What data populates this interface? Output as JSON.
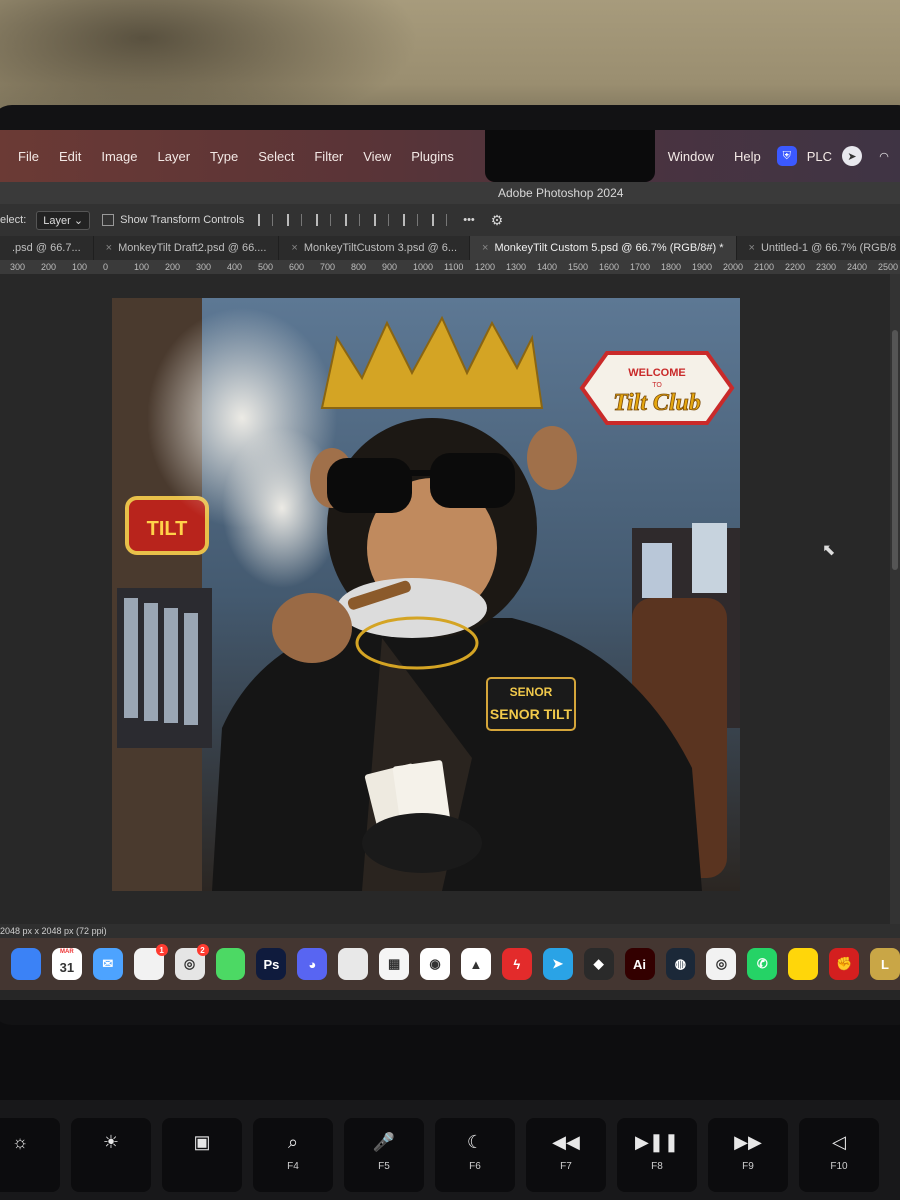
{
  "menubar": {
    "items": [
      "File",
      "Edit",
      "Image",
      "Layer",
      "Type",
      "Select",
      "Filter",
      "View",
      "Plugins"
    ],
    "right_items": [
      "Window",
      "Help"
    ],
    "status": {
      "shield_label": "PLC"
    }
  },
  "window": {
    "title": "Adobe Photoshop 2024"
  },
  "options": {
    "select_label": "elect:",
    "select_value": "Layer",
    "transform_label": "Show Transform Controls",
    "more": "•••"
  },
  "tabs": [
    {
      "label": ".psd @ 66.7...",
      "active": false
    },
    {
      "label": "MonkeyTilt Draft2.psd @ 66....",
      "active": false
    },
    {
      "label": "MonkeyTiltCustom 3.psd @ 6...",
      "active": false
    },
    {
      "label": "MonkeyTilt Custom 5.psd @ 66.7% (RGB/8#) *",
      "active": true
    },
    {
      "label": "Untitled-1 @ 66.7% (RGB/8",
      "active": false
    }
  ],
  "ruler": [
    "300",
    "200",
    "100",
    "0",
    "100",
    "200",
    "300",
    "400",
    "500",
    "600",
    "700",
    "800",
    "900",
    "1000",
    "1100",
    "1200",
    "1300",
    "1400",
    "1500",
    "1600",
    "1700",
    "1800",
    "1900",
    "2000",
    "2100",
    "2200",
    "2300",
    "2400",
    "2500"
  ],
  "artwork": {
    "sign_welcome": "WELCOME",
    "sign_to": "TO",
    "sign_brand": "Tilt Club",
    "left_sign": "TILT",
    "patch_line1": "SENOR",
    "patch_line2": "SENOR TILT"
  },
  "status": {
    "doc_size": "2048 px x 2048 px (72 ppi)"
  },
  "dock": [
    {
      "name": "finder",
      "label": "",
      "color": "#3b82f6"
    },
    {
      "name": "calendar",
      "label": "31",
      "sub": "MAR",
      "color": "#ffffff"
    },
    {
      "name": "mail",
      "label": "✉",
      "color": "#4da3ff"
    },
    {
      "name": "reminders",
      "label": "",
      "color": "#f2f2f2",
      "badge": "1"
    },
    {
      "name": "openai",
      "label": "◎",
      "color": "#e5e5e5",
      "badge": "2"
    },
    {
      "name": "messages",
      "label": "",
      "color": "#4cd964"
    },
    {
      "name": "photoshop",
      "label": "Ps",
      "color": "#0f1b3d"
    },
    {
      "name": "discord",
      "label": "◕",
      "color": "#5865f2"
    },
    {
      "name": "preview",
      "label": "",
      "color": "#e8e8e8"
    },
    {
      "name": "launchpad",
      "label": "▦",
      "color": "#f5f5f5"
    },
    {
      "name": "chrome",
      "label": "◉",
      "color": "#ffffff"
    },
    {
      "name": "nordvpn",
      "label": "▲",
      "color": "#ffffff"
    },
    {
      "name": "bolt",
      "label": "ϟ",
      "color": "#e32b2b"
    },
    {
      "name": "telegram",
      "label": "➤",
      "color": "#2aa3e6"
    },
    {
      "name": "box",
      "label": "◆",
      "color": "#2a2a2a"
    },
    {
      "name": "illustrator",
      "label": "Ai",
      "color": "#330000"
    },
    {
      "name": "steam",
      "label": "◍",
      "color": "#1b2838"
    },
    {
      "name": "chatgpt",
      "label": "◎",
      "color": "#f2f2f2"
    },
    {
      "name": "whatsapp",
      "label": "✆",
      "color": "#25d366"
    },
    {
      "name": "notes",
      "label": "",
      "color": "#ffd60a"
    },
    {
      "name": "fist",
      "label": "✊",
      "color": "#d41f1f"
    },
    {
      "name": "league",
      "label": "L",
      "color": "#c9a646"
    }
  ],
  "fkeys": [
    {
      "sym": "☼",
      "lbl": ""
    },
    {
      "sym": "☀",
      "lbl": ""
    },
    {
      "sym": "▣",
      "lbl": ""
    },
    {
      "sym": "⌕",
      "lbl": "F4"
    },
    {
      "sym": "🎤",
      "lbl": "F5"
    },
    {
      "sym": "☾",
      "lbl": "F6"
    },
    {
      "sym": "◀◀",
      "lbl": "F7"
    },
    {
      "sym": "▶❚❚",
      "lbl": "F8"
    },
    {
      "sym": "▶▶",
      "lbl": "F9"
    },
    {
      "sym": "◁",
      "lbl": "F10"
    }
  ]
}
